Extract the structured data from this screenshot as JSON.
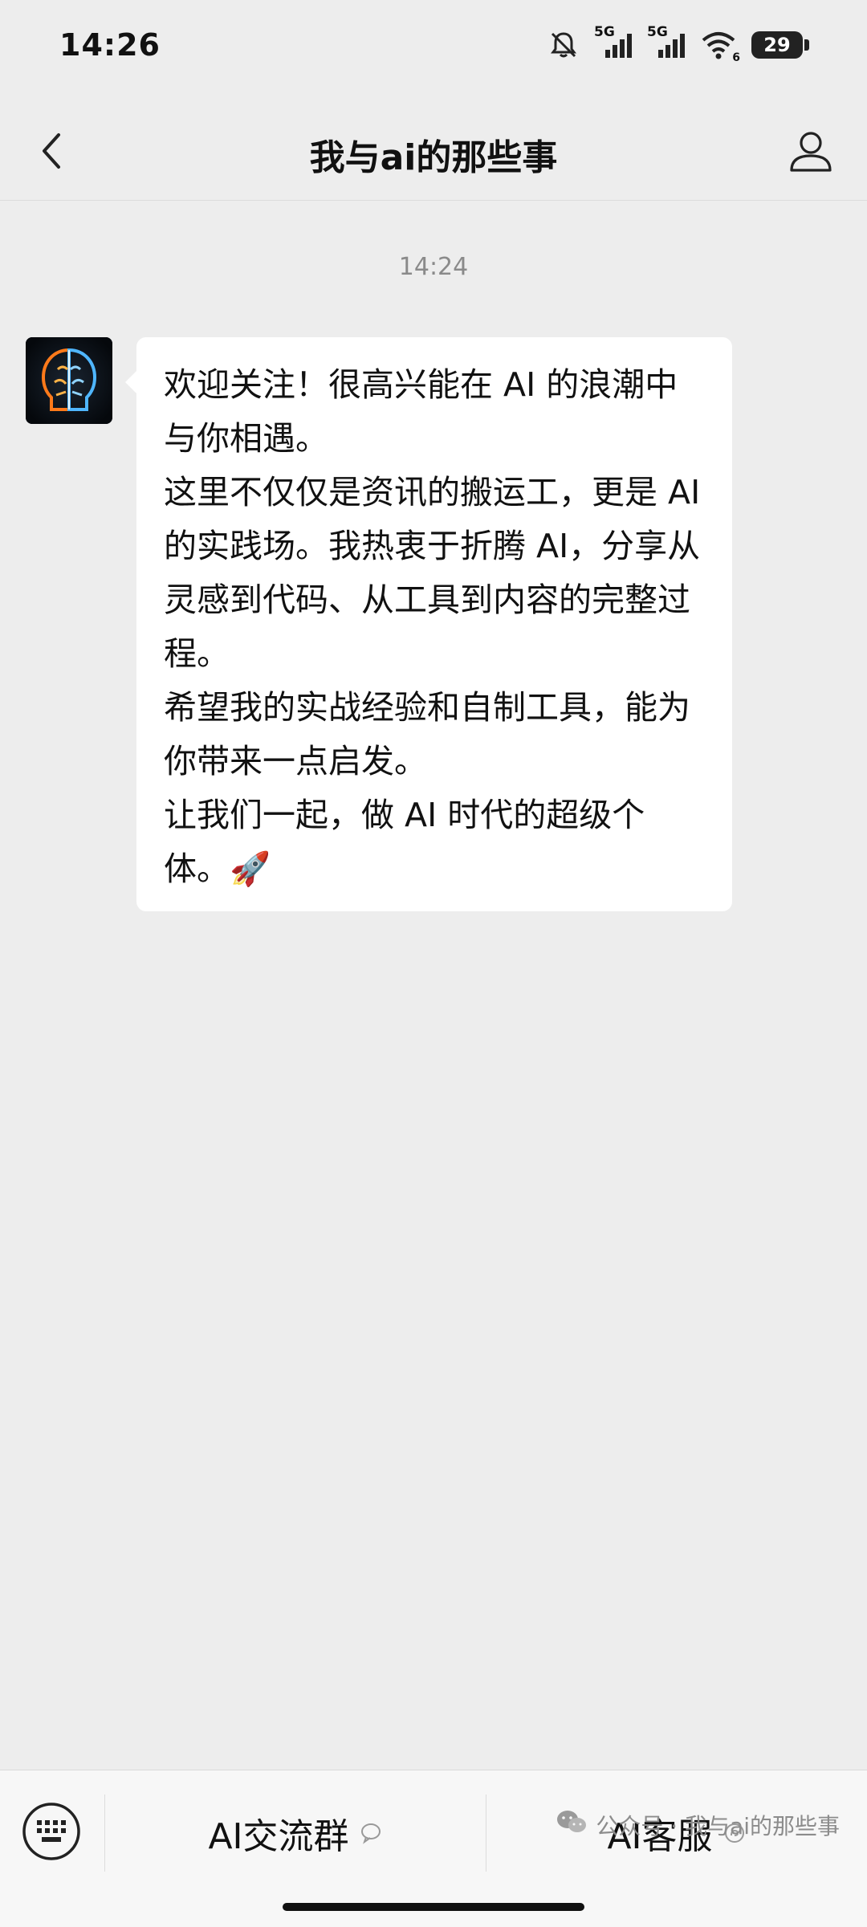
{
  "status_bar": {
    "time": "14:26",
    "network_1": "5G",
    "network_2": "5G",
    "wifi_level": "6",
    "battery": "29",
    "icons": [
      "mute-bell-icon",
      "signal-icon",
      "wifi-icon",
      "battery-icon"
    ]
  },
  "header": {
    "title": "我与ai的那些事",
    "back_icon": "chevron-left-icon",
    "profile_icon": "person-outline-icon"
  },
  "chat": {
    "timestamp": "14:24",
    "messages": [
      {
        "sender": "avatar",
        "text": "欢迎关注！很高兴能在 AI 的浪潮中与你相遇。\n这里不仅仅是资讯的搬运工，更是 AI 的实践场。我热衷于折腾 AI，分享从灵感到代码、从工具到内容的完整过程。\n希望我的实战经验和自制工具，能为你带来一点启发。\n让我们一起，做 AI 时代的超级个体。🚀"
      }
    ]
  },
  "bottom_menu": {
    "keyboard_icon": "keyboard-icon",
    "items": [
      {
        "label": "AI交流群",
        "icon": "chat-bubble-icon"
      },
      {
        "label": "AI客服",
        "icon": "mini-program-icon"
      }
    ]
  },
  "watermark": {
    "text": "公众号 · 我与ai的那些事",
    "icon": "wechat-icon"
  },
  "colors": {
    "background": "#ededed",
    "bubble": "#ffffff",
    "bottom_bar": "#f7f7f7",
    "timestamp": "#8a8a8a"
  }
}
